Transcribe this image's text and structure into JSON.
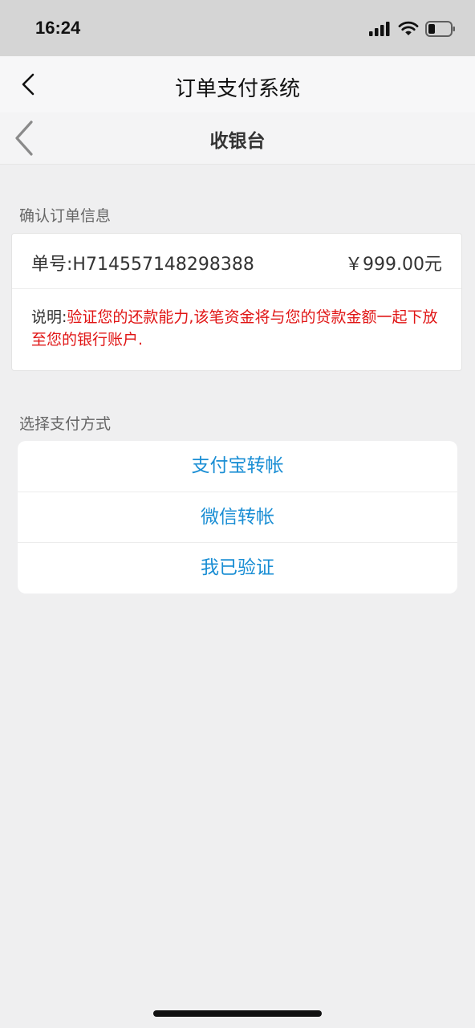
{
  "status": {
    "time": "16:24",
    "icons": [
      "signal-icon",
      "wifi-icon",
      "battery-icon"
    ]
  },
  "nav": {
    "title": "订单支付系统"
  },
  "subheader": {
    "title": "收银台"
  },
  "order_section": {
    "label": "确认订单信息",
    "order_no": "单号:H714557148298388",
    "amount": "￥999.00元",
    "note_prefix": "说明:",
    "note_text": "验证您的还款能力,该笔资金将与您的贷款金额一起下放至您的银行账户."
  },
  "pay_section": {
    "label": "选择支付方式",
    "options": [
      {
        "label": "支付宝转帐"
      },
      {
        "label": "微信转帐"
      },
      {
        "label": "我已验证"
      }
    ]
  },
  "colors": {
    "accent": "#1a8ed4",
    "warning": "#e01515"
  }
}
